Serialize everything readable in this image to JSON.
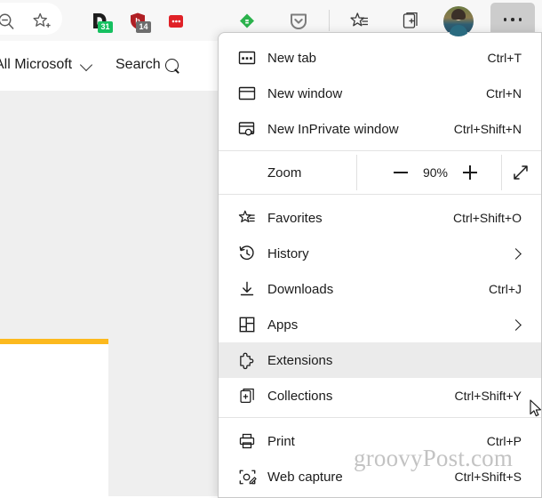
{
  "browser": {
    "toolbar": {
      "icons": [
        {
          "name": "search-zoom-out-icon",
          "label": "Search"
        },
        {
          "name": "add-favorite-star-icon",
          "label": "Add this page to favorites"
        },
        {
          "name": "extension-dashlane-icon",
          "label": "Dashlane",
          "badge": "31"
        },
        {
          "name": "extension-shield-icon",
          "label": "Ad blocker",
          "badge": "14"
        },
        {
          "name": "extension-red-dots-icon",
          "label": "Extension"
        },
        {
          "name": "extension-feedly-icon",
          "label": "Feedly"
        },
        {
          "name": "extension-pocket-icon",
          "label": "Pocket"
        },
        {
          "name": "favorites-star-list-icon",
          "label": "Favorites"
        },
        {
          "name": "collections-icon",
          "label": "Collections"
        },
        {
          "name": "profile-avatar",
          "label": "Profile"
        },
        {
          "name": "settings-and-more-icon",
          "label": "Settings and more"
        }
      ]
    }
  },
  "page": {
    "header": {
      "scope_label": "All Microsoft",
      "search_label": "Search"
    }
  },
  "menu": {
    "groups": [
      {
        "items": [
          {
            "icon": "new-tab-icon",
            "label": "New tab",
            "accel": "Ctrl+T",
            "chevron": false,
            "highlighted": false
          },
          {
            "icon": "new-window-icon",
            "label": "New window",
            "accel": "Ctrl+N",
            "chevron": false,
            "highlighted": false
          },
          {
            "icon": "inprivate-icon",
            "label": "New InPrivate window",
            "accel": "Ctrl+Shift+N",
            "chevron": false,
            "highlighted": false
          }
        ]
      }
    ],
    "zoom": {
      "label": "Zoom",
      "level": "90%",
      "decrease_name": "zoom-out-button",
      "increase_name": "zoom-in-button",
      "fullscreen_name": "full-screen-button"
    },
    "group2": [
      {
        "icon": "favorites-icon",
        "label": "Favorites",
        "accel": "Ctrl+Shift+O",
        "chevron": false,
        "highlighted": false
      },
      {
        "icon": "history-icon",
        "label": "History",
        "accel": "",
        "chevron": true,
        "highlighted": false
      },
      {
        "icon": "downloads-icon",
        "label": "Downloads",
        "accel": "Ctrl+J",
        "chevron": false,
        "highlighted": false
      },
      {
        "icon": "apps-icon",
        "label": "Apps",
        "accel": "",
        "chevron": true,
        "highlighted": false
      },
      {
        "icon": "extensions-icon",
        "label": "Extensions",
        "accel": "",
        "chevron": false,
        "highlighted": true
      },
      {
        "icon": "collections-icon",
        "label": "Collections",
        "accel": "Ctrl+Shift+Y",
        "chevron": false,
        "highlighted": false
      }
    ],
    "group3": [
      {
        "icon": "print-icon",
        "label": "Print",
        "accel": "Ctrl+P",
        "chevron": false,
        "highlighted": false
      },
      {
        "icon": "web-capture-icon",
        "label": "Web capture",
        "accel": "Ctrl+Shift+S",
        "chevron": false,
        "highlighted": false
      }
    ]
  },
  "watermark": {
    "text": "groovyPost.com"
  },
  "colors": {
    "accent_yellow": "#fcb91e",
    "badge_green": "#16c060",
    "badge_gray": "#6d6d6d",
    "highlight_row": "#ebebeb",
    "chrome_bg": "#f7f7f7"
  }
}
